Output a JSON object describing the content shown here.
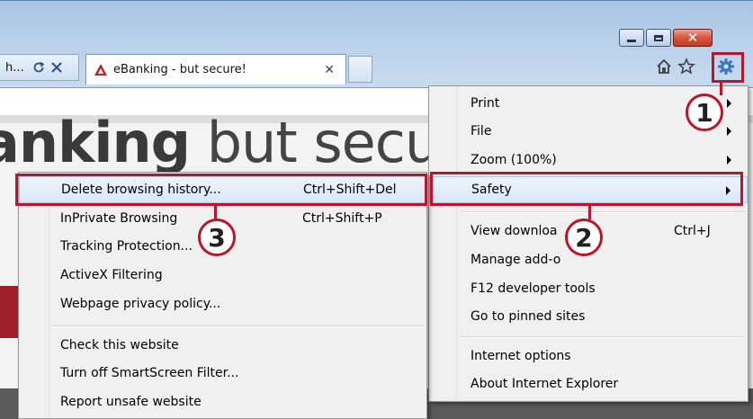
{
  "tabs": {
    "previous_label": "h...",
    "active_title": "eBanking - but secure!",
    "close_glyph": "✕"
  },
  "page": {
    "hero_bold": "anking",
    "hero_light": " but secu"
  },
  "menu": {
    "items": [
      {
        "label": "Print",
        "submenu": true
      },
      {
        "label": "File",
        "submenu": true
      },
      {
        "label": "Zoom (100%)",
        "submenu": true
      },
      {
        "label": "Safety",
        "submenu": true
      },
      {
        "label": "View downloa",
        "shortcut": "Ctrl+J"
      },
      {
        "label": "Manage add-o"
      },
      {
        "label": "F12 developer tools"
      },
      {
        "label": "Go to pinned sites"
      },
      {
        "label": "Internet options"
      },
      {
        "label": "About Internet Explorer"
      }
    ]
  },
  "safety_submenu": {
    "items": [
      {
        "label": "Delete browsing history...",
        "shortcut": "Ctrl+Shift+Del"
      },
      {
        "label": "InPrivate Browsing",
        "shortcut": "Ctrl+Shift+P"
      },
      {
        "label": "Tracking Protection..."
      },
      {
        "label": "ActiveX Filtering"
      },
      {
        "label": "Webpage privacy policy..."
      },
      {
        "label": "Check this website"
      },
      {
        "label": "Turn off SmartScreen Filter..."
      },
      {
        "label": "Report unsafe website"
      }
    ]
  },
  "annotations": {
    "step1": "1",
    "step2": "2",
    "step3": "3"
  },
  "colors": {
    "annotation_red": "#b8172b",
    "brand_red": "#a11e2b"
  },
  "icons": [
    "refresh-icon",
    "stop-icon",
    "home-icon",
    "favorites-star-icon",
    "tools-gear-icon",
    "minimize-icon",
    "maximize-icon",
    "close-icon"
  ]
}
